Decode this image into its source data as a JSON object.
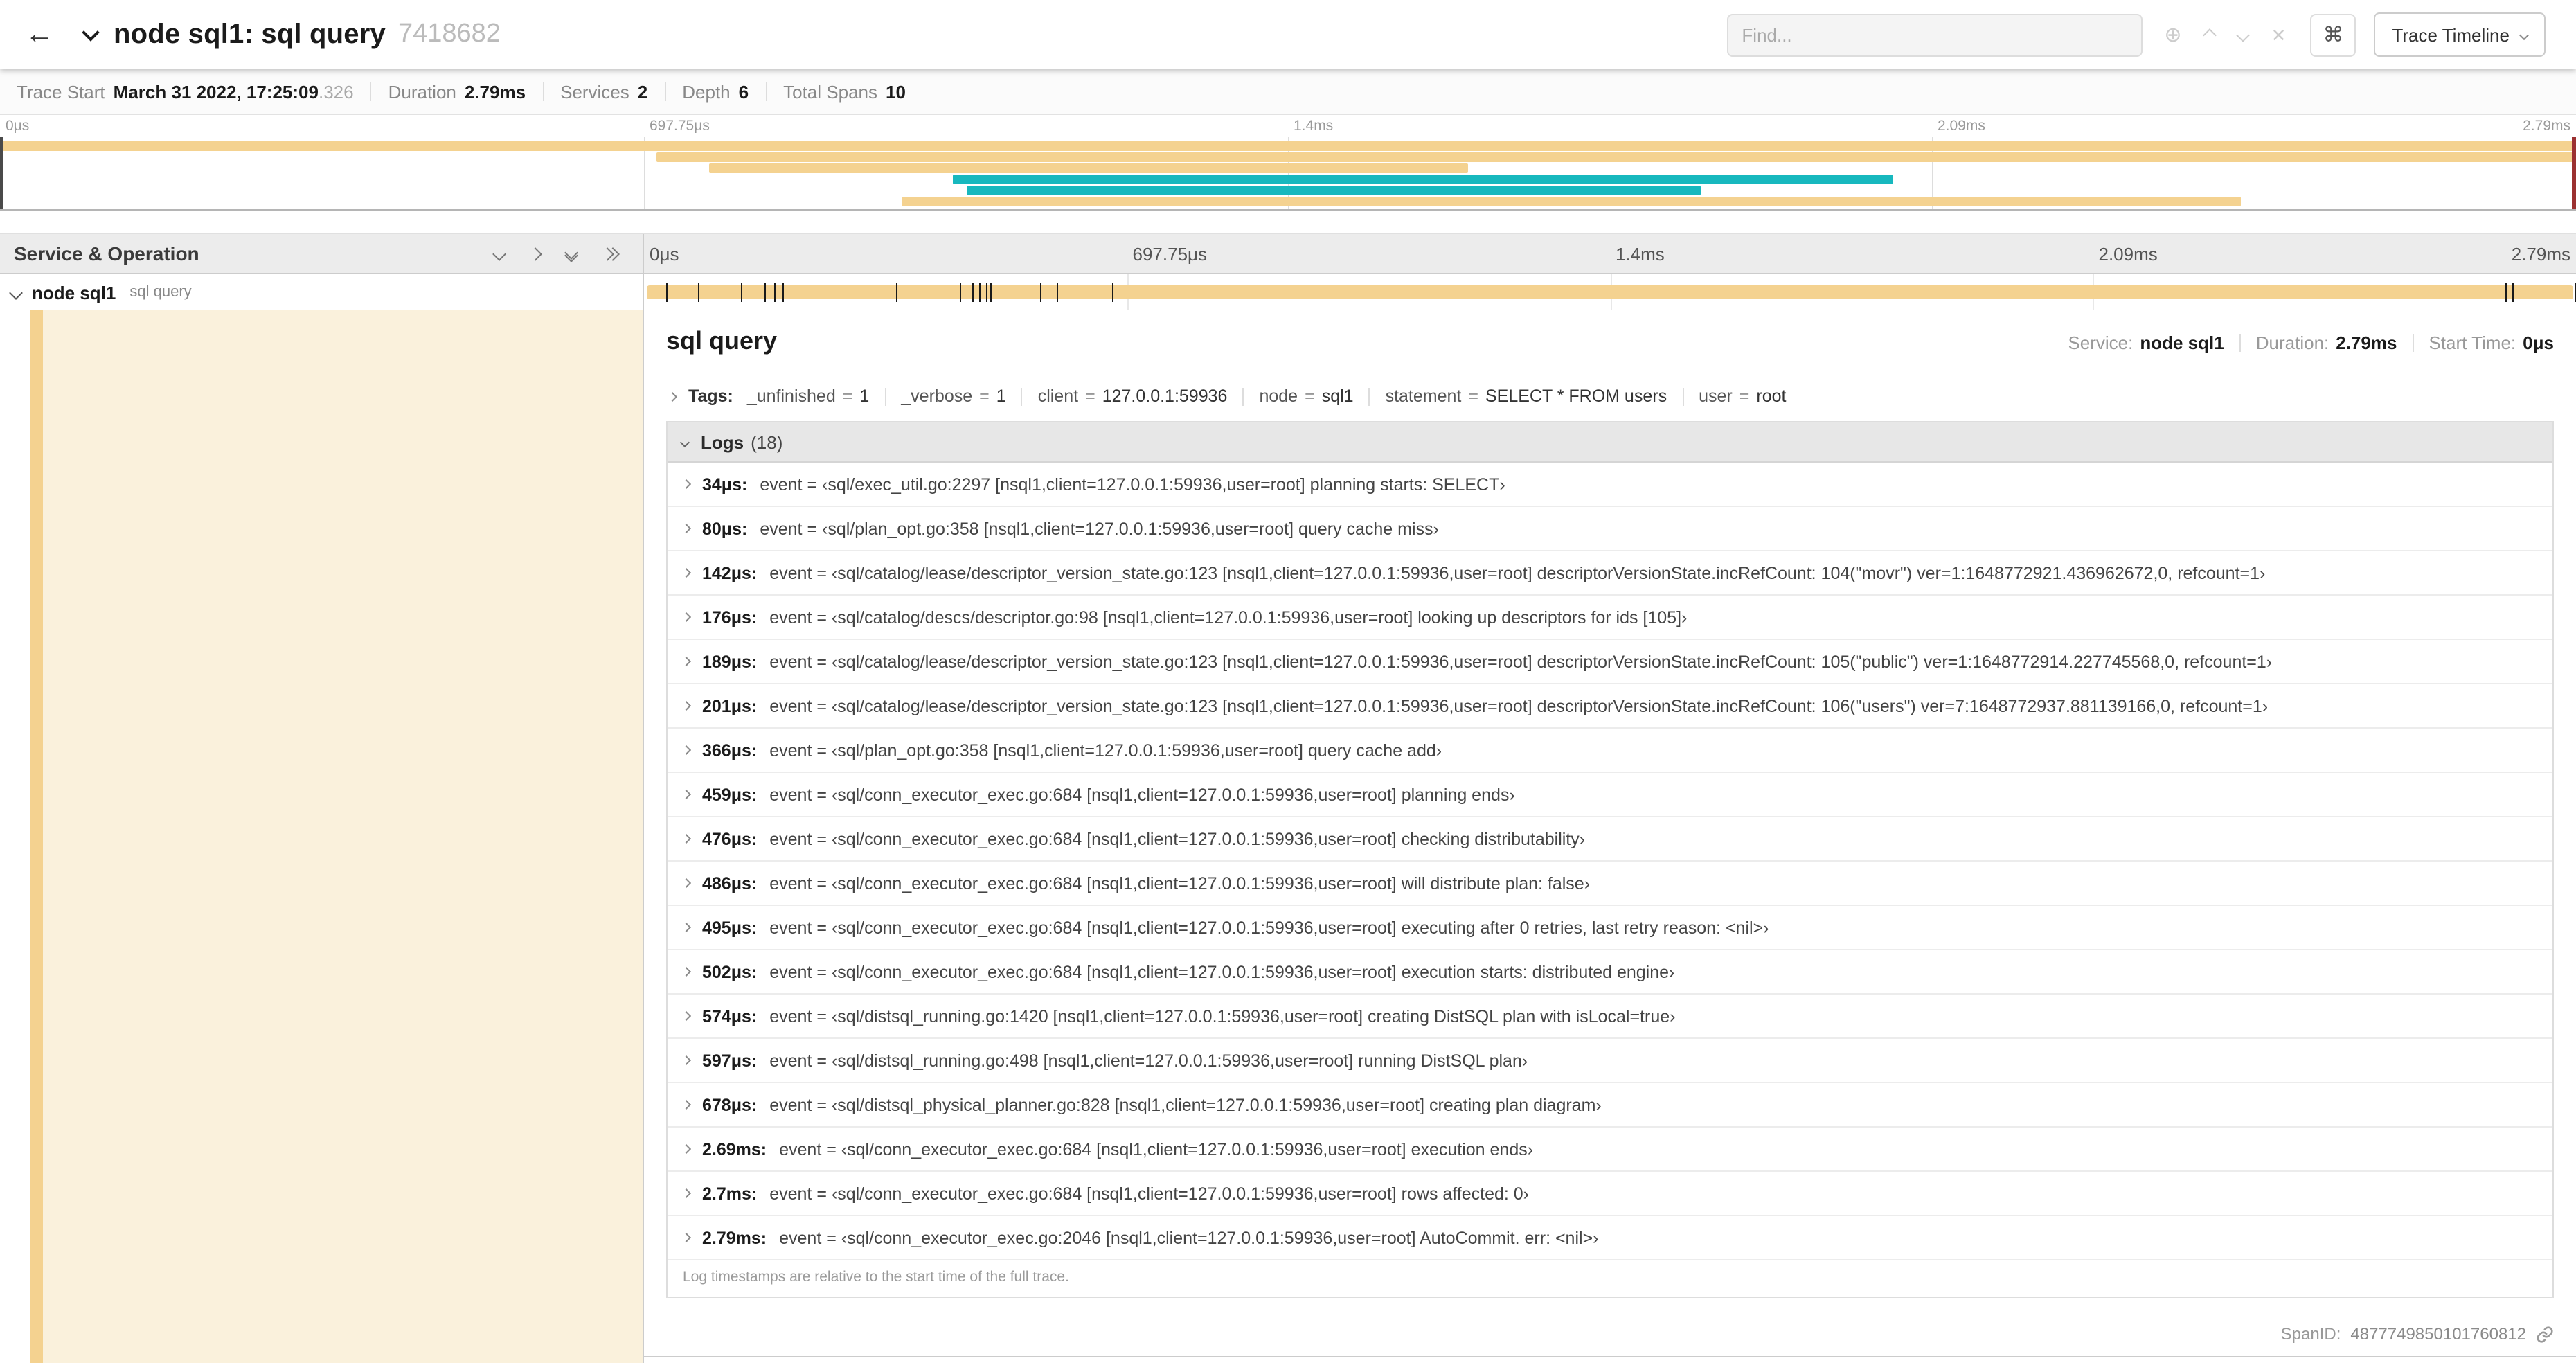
{
  "header": {
    "back_icon": "←",
    "title": "node sql1: sql query",
    "trace_id": "7418682",
    "search_placeholder": "Find...",
    "focus_icon_glyph": "⊕",
    "close_icon_glyph": "×",
    "shortcut_icon": "⌘",
    "view_selector": "Trace Timeline"
  },
  "summary": {
    "items": [
      {
        "label": "Trace Start",
        "value": "March 31 2022, 17:25:09",
        "suffix": ".326"
      },
      {
        "label": "Duration",
        "value": "2.79ms"
      },
      {
        "label": "Services",
        "value": "2"
      },
      {
        "label": "Depth",
        "value": "6"
      },
      {
        "label": "Total Spans",
        "value": "10"
      }
    ]
  },
  "timeline": {
    "ticks": [
      "0μs",
      "697.75μs",
      "1.4ms",
      "2.09ms",
      "2.79ms"
    ],
    "duration_us": 2790
  },
  "minimap": {
    "bars": [
      {
        "row": 0,
        "start": 0,
        "end": 100,
        "color": "tan"
      },
      {
        "row": 1,
        "start": 25.5,
        "end": 100,
        "color": "tan"
      },
      {
        "row": 2,
        "start": 27.5,
        "end": 57,
        "color": "tan"
      },
      {
        "row": 3,
        "start": 37,
        "end": 73.5,
        "color": "teal"
      },
      {
        "row": 4,
        "start": 37.5,
        "end": 66,
        "color": "teal"
      },
      {
        "row": 5,
        "start": 35,
        "end": 87,
        "color": "tan"
      }
    ]
  },
  "span_table": {
    "header_left": "Service & Operation",
    "row": {
      "service": "node sql1",
      "operation": "sql query"
    }
  },
  "detail": {
    "title": "sql query",
    "meta": {
      "service_label": "Service:",
      "service_value": "node sql1",
      "duration_label": "Duration:",
      "duration_value": "2.79ms",
      "start_label": "Start Time:",
      "start_value": "0μs"
    },
    "tags_label": "Tags:",
    "tags": [
      {
        "key": "_unfinished",
        "value": "1"
      },
      {
        "key": "_verbose",
        "value": "1"
      },
      {
        "key": "client",
        "value": "127.0.0.1:59936"
      },
      {
        "key": "node",
        "value": "sql1"
      },
      {
        "key": "statement",
        "value": "SELECT * FROM users"
      },
      {
        "key": "user",
        "value": "root"
      }
    ],
    "logs_label": "Logs",
    "logs_count": "(18)",
    "logs": [
      {
        "time": "34μs",
        "us": 34,
        "event": "‹sql/exec_util.go:2297 [nsql1,client=127.0.0.1:59936,user=root] planning starts: SELECT›"
      },
      {
        "time": "80μs",
        "us": 80,
        "event": "‹sql/plan_opt.go:358 [nsql1,client=127.0.0.1:59936,user=root] query cache miss›"
      },
      {
        "time": "142μs",
        "us": 142,
        "event": "‹sql/catalog/lease/descriptor_version_state.go:123 [nsql1,client=127.0.0.1:59936,user=root] descriptorVersionState.incRefCount: 104(\"movr\") ver=1:1648772921.436962672,0, refcount=1›"
      },
      {
        "time": "176μs",
        "us": 176,
        "event": "‹sql/catalog/descs/descriptor.go:98 [nsql1,client=127.0.0.1:59936,user=root] looking up descriptors for ids [105]›"
      },
      {
        "time": "189μs",
        "us": 189,
        "event": "‹sql/catalog/lease/descriptor_version_state.go:123 [nsql1,client=127.0.0.1:59936,user=root] descriptorVersionState.incRefCount: 105(\"public\") ver=1:1648772914.227745568,0, refcount=1›"
      },
      {
        "time": "201μs",
        "us": 201,
        "event": "‹sql/catalog/lease/descriptor_version_state.go:123 [nsql1,client=127.0.0.1:59936,user=root] descriptorVersionState.incRefCount: 106(\"users\") ver=7:1648772937.881139166,0, refcount=1›"
      },
      {
        "time": "366μs",
        "us": 366,
        "event": "‹sql/plan_opt.go:358 [nsql1,client=127.0.0.1:59936,user=root] query cache add›"
      },
      {
        "time": "459μs",
        "us": 459,
        "event": "‹sql/conn_executor_exec.go:684 [nsql1,client=127.0.0.1:59936,user=root] planning ends›"
      },
      {
        "time": "476μs",
        "us": 476,
        "event": "‹sql/conn_executor_exec.go:684 [nsql1,client=127.0.0.1:59936,user=root] checking distributability›"
      },
      {
        "time": "486μs",
        "us": 486,
        "event": "‹sql/conn_executor_exec.go:684 [nsql1,client=127.0.0.1:59936,user=root] will distribute plan: false›"
      },
      {
        "time": "495μs",
        "us": 495,
        "event": "‹sql/conn_executor_exec.go:684 [nsql1,client=127.0.0.1:59936,user=root] executing after 0 retries, last retry reason: <nil>›"
      },
      {
        "time": "502μs",
        "us": 502,
        "event": "‹sql/conn_executor_exec.go:684 [nsql1,client=127.0.0.1:59936,user=root] execution starts: distributed engine›"
      },
      {
        "time": "574μs",
        "us": 574,
        "event": "‹sql/distsql_running.go:1420 [nsql1,client=127.0.0.1:59936,user=root] creating DistSQL plan with isLocal=true›"
      },
      {
        "time": "597μs",
        "us": 597,
        "event": "‹sql/distsql_running.go:498 [nsql1,client=127.0.0.1:59936,user=root] running DistSQL plan›"
      },
      {
        "time": "678μs",
        "us": 678,
        "event": "‹sql/distsql_physical_planner.go:828 [nsql1,client=127.0.0.1:59936,user=root] creating plan diagram›"
      },
      {
        "time": "2.69ms",
        "us": 2690,
        "event": "‹sql/conn_executor_exec.go:684 [nsql1,client=127.0.0.1:59936,user=root] execution ends›"
      },
      {
        "time": "2.7ms",
        "us": 2700,
        "event": "‹sql/conn_executor_exec.go:684 [nsql1,client=127.0.0.1:59936,user=root] rows affected: 0›"
      },
      {
        "time": "2.79ms",
        "us": 2790,
        "event": "‹sql/conn_executor_exec.go:2046 [nsql1,client=127.0.0.1:59936,user=root] AutoCommit. err: <nil>›"
      }
    ],
    "logs_note": "Log timestamps are relative to the start time of the full trace.",
    "footer": {
      "span_id_label": "SpanID:",
      "span_id": "4877749850101760812"
    }
  },
  "colors": {
    "tan": "#f4d290",
    "teal": "#17b8be",
    "cream": "#faf1dc"
  }
}
